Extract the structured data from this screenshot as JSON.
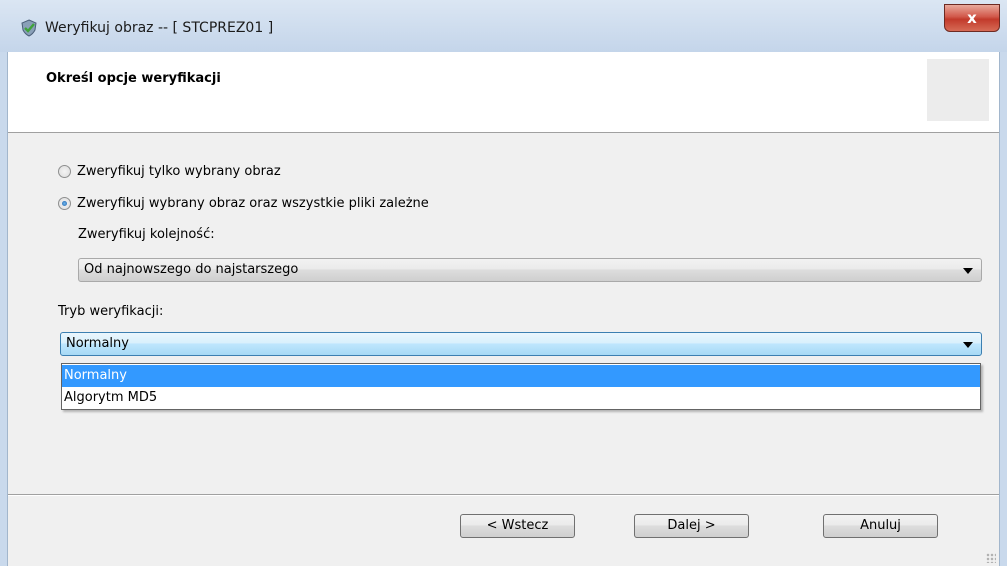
{
  "window": {
    "title": "Weryfikuj obraz -- [ STCPREZ01 ]",
    "close_label": "x",
    "icon": "shield-check-icon"
  },
  "header": {
    "title": "Określ opcje weryfikacji"
  },
  "options": {
    "verify_only_selected": "Zweryfikuj tylko wybrany obraz",
    "verify_selected_and_dependents": "Zweryfikuj wybrany obraz oraz wszystkie pliki zależne",
    "selected_option": "verify_selected_and_dependents"
  },
  "order": {
    "label": "Zweryfikuj kolejność:",
    "value": "Od najnowszego do najstarszego"
  },
  "mode": {
    "label": "Tryb weryfikacji:",
    "value": "Normalny",
    "options": [
      "Normalny",
      "Algorytm MD5"
    ],
    "highlighted": "Normalny"
  },
  "buttons": {
    "back": "< Wstecz",
    "next": "Dalej >",
    "cancel": "Anuluj"
  },
  "colors": {
    "selection": "#3399ff",
    "close_button": "#c23a2b"
  }
}
